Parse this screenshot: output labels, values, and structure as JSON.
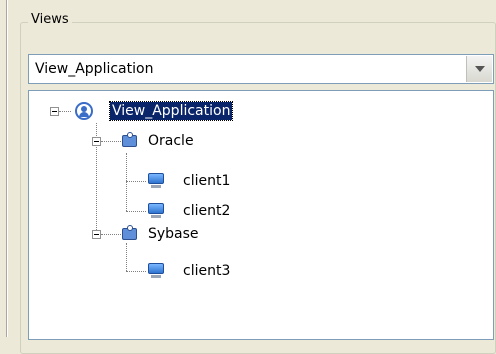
{
  "group": {
    "legend": "Views"
  },
  "combo": {
    "value": "View_Application",
    "icon": "chevron-down-icon"
  },
  "tree": {
    "root": {
      "label": "View_Application",
      "icon": "application-icon",
      "selected": true
    },
    "groups": [
      {
        "label": "Oracle",
        "icon": "database-group-icon",
        "clients": [
          "client1",
          "client2"
        ]
      },
      {
        "label": "Sybase",
        "icon": "database-group-icon",
        "clients": [
          "client3"
        ]
      }
    ],
    "client_icon": "monitor-icon"
  },
  "colors": {
    "selection_background": "#0a246a",
    "border": "#7f9db9",
    "window_background": "#ece9d8"
  }
}
